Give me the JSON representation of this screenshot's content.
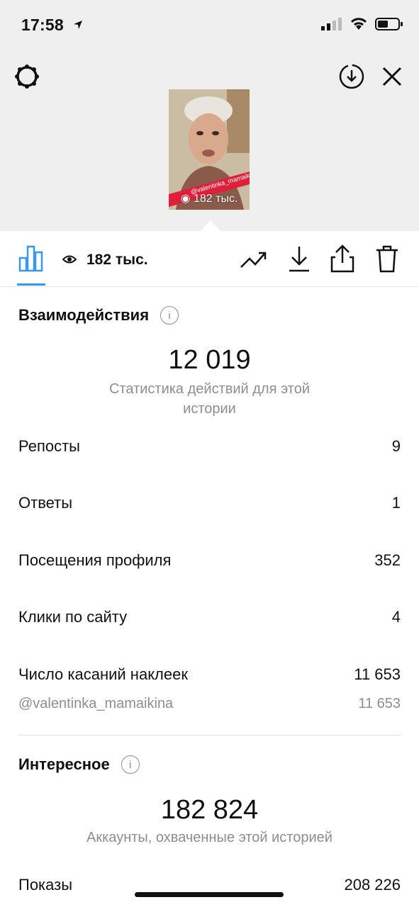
{
  "status_bar": {
    "time": "17:58"
  },
  "story": {
    "thumb_handle": "@valentinka_mamaikina",
    "thumb_views": "182 тыс."
  },
  "toolbar": {
    "views": "182 тыс."
  },
  "interactions": {
    "title": "Взаимодействия",
    "total": "12 019",
    "caption": "Статистика действий для этой истории",
    "rows": [
      {
        "label": "Репосты",
        "value": "9"
      },
      {
        "label": "Ответы",
        "value": "1"
      },
      {
        "label": "Посещения профиля",
        "value": "352"
      },
      {
        "label": "Клики по сайту",
        "value": "4"
      },
      {
        "label": "Число касаний наклеек",
        "value": "11 653"
      }
    ],
    "sub_row": {
      "label": "@valentinka_mamaikina",
      "value": "11 653"
    }
  },
  "discovery": {
    "title": "Интересное",
    "total": "182 824",
    "caption": "Аккаунты, охваченные этой историей",
    "rows": [
      {
        "label": "Показы",
        "value": "208 226"
      }
    ]
  },
  "colors": {
    "accent": "#3897f0",
    "muted": "#8e8e8e"
  }
}
